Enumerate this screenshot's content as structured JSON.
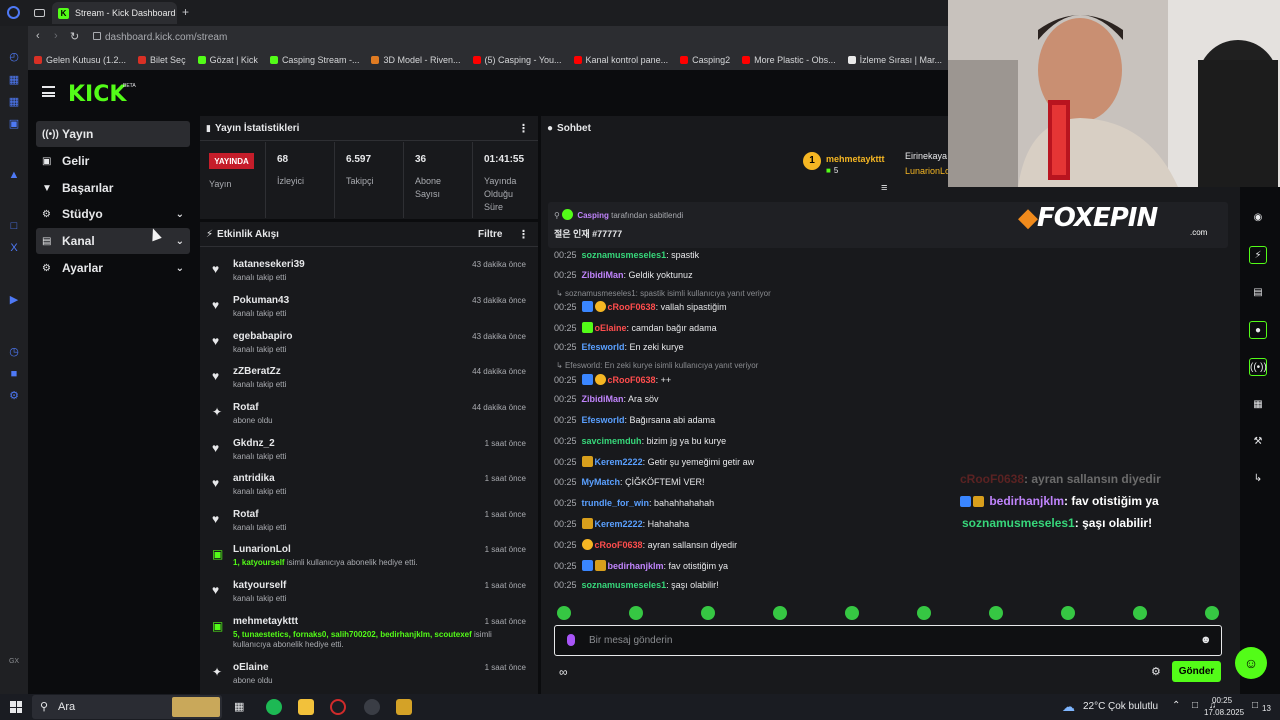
{
  "browser": {
    "tab_title": "Stream - Kick Dashboard",
    "new_tab": "+",
    "url": "dashboard.kick.com/stream",
    "bookmarks": [
      {
        "label": "Gelen Kutusu (1.2...",
        "color": "#d93025"
      },
      {
        "label": "Bilet Seç",
        "color": "#d93025"
      },
      {
        "label": "Gözat | Kick",
        "color": "#53fc18"
      },
      {
        "label": "Casping Stream -...",
        "color": "#53fc18"
      },
      {
        "label": "3D Model - Riven...",
        "color": "#e07b22"
      },
      {
        "label": "(5) Casping - You...",
        "color": "#ff0000"
      },
      {
        "label": "Kanal kontrol pane...",
        "color": "#ff0000"
      },
      {
        "label": "Casping2",
        "color": "#ff0000"
      },
      {
        "label": "More Plastic - Obs...",
        "color": "#ff0000"
      },
      {
        "label": "İzleme Sırası | Mar...",
        "color": "#e9e9e9"
      }
    ]
  },
  "brand": {
    "logo": "KICK",
    "beta": "BETA",
    "accent": "#53fc18"
  },
  "sidebar": {
    "items": [
      {
        "label": "Yayın",
        "icon": "broadcast-icon"
      },
      {
        "label": "Gelir",
        "icon": "wallet-icon"
      },
      {
        "label": "Başarılar",
        "icon": "trophy-icon"
      },
      {
        "label": "Stüdyo",
        "icon": "gear-icon"
      },
      {
        "label": "Kanal",
        "icon": "channel-icon"
      },
      {
        "label": "Ayarlar",
        "icon": "settings-icon"
      }
    ]
  },
  "stats": {
    "title": "Yayın İstatistikleri",
    "live_label": "YAYINDA",
    "status_label": "Yayın",
    "viewers": {
      "value": "68",
      "label": "İzleyici"
    },
    "followers": {
      "value": "6.597",
      "label": "Takipçi"
    },
    "subscribers": {
      "value": "36",
      "label": "Abone Sayısı"
    },
    "duration": {
      "value": "01:41:55",
      "label": "Yayında Olduğu Süre"
    }
  },
  "activity": {
    "title": "Etkinlik Akışı",
    "filter": "Filtre",
    "events": [
      {
        "name": "katanesekeri39",
        "desc": "kanalı takip etti",
        "time": "43 dakika önce",
        "icon": "heart"
      },
      {
        "name": "Pokuman43",
        "desc": "kanalı takip etti",
        "time": "43 dakika önce",
        "icon": "heart"
      },
      {
        "name": "egebabapiro",
        "desc": "kanalı takip etti",
        "time": "43 dakika önce",
        "icon": "heart"
      },
      {
        "name": "zZBeratZz",
        "desc": "kanalı takip etti",
        "time": "44 dakika önce",
        "icon": "heart"
      },
      {
        "name": "Rotaf",
        "desc": "abone oldu",
        "time": "44 dakika önce",
        "icon": "sparkle"
      },
      {
        "name": "Gkdnz_2",
        "desc": "kanalı takip etti",
        "time": "1 saat önce",
        "icon": "heart"
      },
      {
        "name": "antridika",
        "desc": "kanalı takip etti",
        "time": "1 saat önce",
        "icon": "heart"
      },
      {
        "name": "Rotaf",
        "desc": "kanalı takip etti",
        "time": "1 saat önce",
        "icon": "heart"
      },
      {
        "name": "LunarionLol",
        "desc_highlight": "1, katyourself",
        "desc": "isimli kullanıcıya abonelik hediye etti.",
        "time": "1 saat önce",
        "icon": "gift"
      },
      {
        "name": "katyourself",
        "desc": "kanalı takip etti",
        "time": "1 saat önce",
        "icon": "heart"
      },
      {
        "name": "mehmetaykttt",
        "desc_highlight": "5, tunaestetics, fornaks0, salih700202, bedirhanjklm, scoutexef",
        "desc": "isimli kullanıcıya abonelik hediye etti.",
        "time": "1 saat önce",
        "icon": "gift"
      },
      {
        "name": "oElaine",
        "desc": "abone oldu",
        "time": "1 saat önce",
        "icon": "sparkle"
      }
    ]
  },
  "chat": {
    "title": "Sohbet",
    "top_gifter": {
      "rank": "1",
      "name": "mehmetaykttt",
      "count": "5"
    },
    "side_gifters": [
      "Eirinekaya",
      "LunarionLo"
    ],
    "pinned": {
      "by": "Casping",
      "by_suffix": "tarafından sabitlendi",
      "text": "절은 인재 #77777"
    },
    "messages": [
      {
        "kind": "msg",
        "time": "00:25",
        "user": "soznamusmeseles1",
        "color": "#37d67a",
        "text": ": spastik"
      },
      {
        "kind": "msg",
        "time": "00:25",
        "user": "ZibidiMan",
        "color": "#c084fc",
        "text": ": Geldik yoktunuz"
      },
      {
        "kind": "reply",
        "text": "soznamusmeseles1: spastik isimli kullanıcıya yanıt veriyor"
      },
      {
        "kind": "msg",
        "time": "00:25",
        "user": "cRooF0638",
        "color": "#ff4d4d",
        "text": ": vallah sipastiğim",
        "badges": [
          "b-blue",
          "b-gold"
        ]
      },
      {
        "kind": "msg",
        "time": "00:25",
        "user": "oElaine",
        "color": "#ff4d4d",
        "text": ": camdan bağır adama",
        "badges": [
          "b-green"
        ]
      },
      {
        "kind": "msg",
        "time": "00:25",
        "user": "Efesworld",
        "color": "#5aa0ff",
        "text": ": En zeki kurye"
      },
      {
        "kind": "reply",
        "text": "Efesworld: En zeki kurye isimli kullanıcıya yanıt veriyor"
      },
      {
        "kind": "msg",
        "time": "00:25",
        "user": "cRooF0638",
        "color": "#ff4d4d",
        "text": ": ++",
        "badges": [
          "b-blue",
          "b-gold"
        ]
      },
      {
        "kind": "msg",
        "time": "00:25",
        "user": "ZibidiMan",
        "color": "#c084fc",
        "text": ": Ara söv"
      },
      {
        "kind": "msg",
        "time": "00:25",
        "user": "Efesworld",
        "color": "#5aa0ff",
        "text": ": Bağırsana abi adama"
      },
      {
        "kind": "msg",
        "time": "00:25",
        "user": "savcimemduh",
        "color": "#37d67a",
        "text": ": bizim jg ya bu kurye"
      },
      {
        "kind": "msg",
        "time": "00:25",
        "user": "Kerem2222",
        "color": "#5aa0ff",
        "text": ": Getir şu yemeğimi getir aw",
        "badges": [
          "b-crown"
        ]
      },
      {
        "kind": "msg",
        "time": "00:25",
        "user": "MyMatch",
        "color": "#5aa0ff",
        "text": ": ÇİĞKÖFTEMİ VER!"
      },
      {
        "kind": "msg",
        "time": "00:25",
        "user": "trundle_for_win",
        "color": "#5aa0ff",
        "text": ": bahahhahahah"
      },
      {
        "kind": "msg",
        "time": "00:25",
        "user": "Kerem2222",
        "color": "#5aa0ff",
        "text": ": Hahahaha",
        "badges": [
          "b-crown"
        ]
      },
      {
        "kind": "msg",
        "time": "00:25",
        "user": "cRooF0638",
        "color": "#ff4d4d",
        "text": ": ayran sallansın diyedir",
        "badges": [
          "b-gold"
        ]
      },
      {
        "kind": "msg",
        "time": "00:25",
        "user": "bedirhanjklm",
        "color": "#c084fc",
        "text": ": fav otistiğim ya",
        "badges": [
          "b-blue",
          "b-crown"
        ]
      },
      {
        "kind": "msg",
        "time": "00:25",
        "user": "soznamusmeseles1",
        "color": "#37d67a",
        "text": ": şaşı olabilir!"
      }
    ],
    "input_placeholder": "Bir mesaj gönderin",
    "send_label": "Gönder"
  },
  "overlay": {
    "sponsor": "FOXEPIN",
    "sponsor_sub": ".com",
    "lines": [
      {
        "user": "cRooF0638",
        "text": ": ayran sallansın diyedir"
      },
      {
        "user": "bedirhanjklm",
        "text": ": fav otistiğim ya"
      },
      {
        "user": "soznamusmeseles1",
        "text": ": şaşı olabilir!"
      }
    ]
  },
  "taskbar": {
    "search": "Ara",
    "weather": "22°C",
    "weather_text": "Çok bulutlu",
    "time": "00:25",
    "date": "17.08.2025",
    "notifications": "13",
    "rail_label": "GX"
  }
}
